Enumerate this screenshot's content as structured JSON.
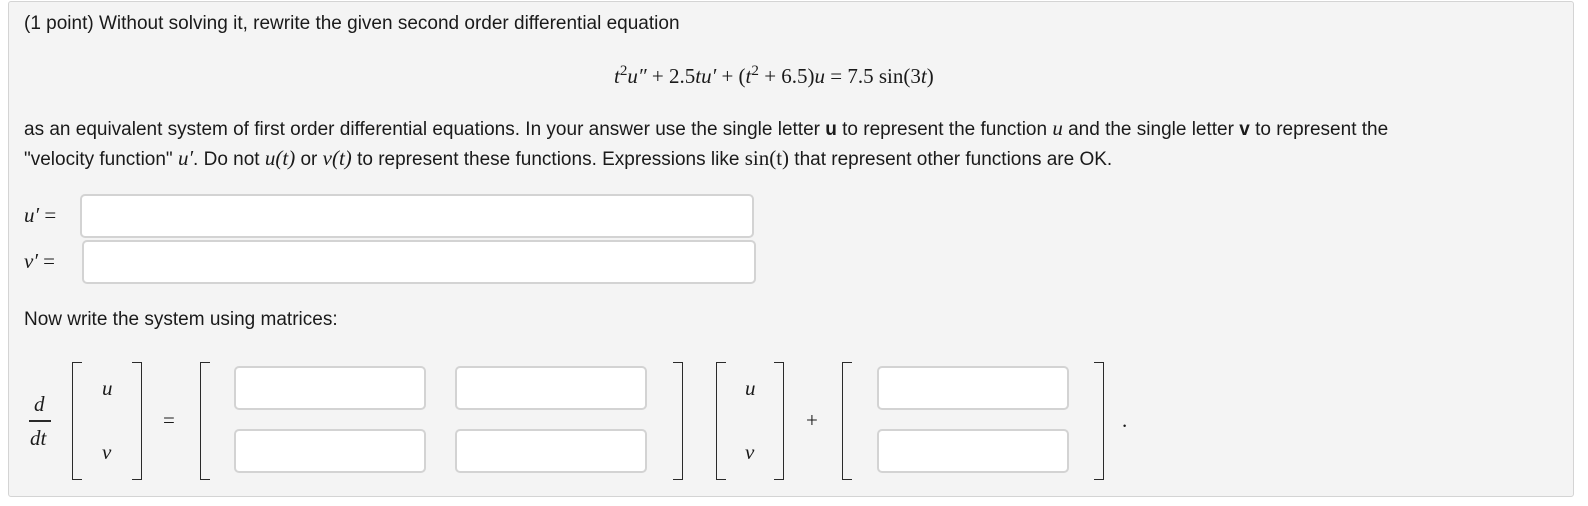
{
  "intro": "(1 point) Without solving it, rewrite the given second order differential equation",
  "equation": {
    "t1": "t",
    "s1": "2",
    "u1": "u″",
    "plus1": "+ 2.5",
    "tu": "tu′",
    "plus2": "+ (",
    "t2": "t",
    "s2": "2",
    "plus3": "+ 6.5)",
    "u2": "u",
    "eq": "= 7.5 sin(3",
    "t3": "t",
    "close": ")"
  },
  "instructions": {
    "line1": {
      "a": "as an equivalent system of first order differential equations. In your answer use the single letter ",
      "u_bold": "u",
      "b": " to represent the function ",
      "u_math": "u",
      "c": " and the single letter ",
      "v_bold": "v",
      "d": " to represent the"
    },
    "line2": {
      "a": "\"velocity function\" ",
      "uprime": "u′",
      "b": ". Do not ",
      "ut": "u(t)",
      "c": " or ",
      "vt": "v(t)",
      "d": " to represent these functions. Expressions like ",
      "sint": "sin(t)",
      "e": " that represent other functions are OK."
    }
  },
  "first_order": {
    "u_label": "u′",
    "v_label": "v′",
    "equals": "=",
    "u_value": "",
    "v_value": ""
  },
  "matrix_prompt": "Now write the system using matrices:",
  "matrix": {
    "d": "d",
    "dt": "dt",
    "vec_u": "u",
    "vec_v": "v",
    "equals": "=",
    "plus": "+",
    "period": ".",
    "a11": "",
    "a12": "",
    "a21": "",
    "a22": "",
    "b1": "",
    "b2": ""
  }
}
